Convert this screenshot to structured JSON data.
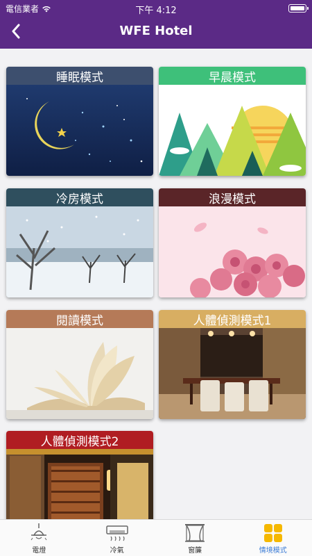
{
  "status_bar": {
    "carrier": "電信業者",
    "time": "下午 4:12"
  },
  "header": {
    "title": "WFE Hotel"
  },
  "scenes": [
    {
      "label": "睡眠模式",
      "color": "#3d4f6e"
    },
    {
      "label": "早晨模式",
      "color": "#3ec07a"
    },
    {
      "label": "冷房模式",
      "color": "#2f4f5e"
    },
    {
      "label": "浪漫模式",
      "color": "#5a2528"
    },
    {
      "label": "閱讀模式",
      "color": "#b57a58"
    },
    {
      "label": "人體偵測模式1",
      "color": "#d8ae62"
    },
    {
      "label": "人體偵測模式2",
      "color": "#b01d22"
    }
  ],
  "tabs": [
    {
      "label": "電燈",
      "icon": "lamp-icon"
    },
    {
      "label": "冷氣",
      "icon": "air-conditioner-icon"
    },
    {
      "label": "窗簾",
      "icon": "curtain-icon"
    },
    {
      "label": "情境模式",
      "icon": "scene-grid-icon",
      "active": true
    }
  ],
  "colors": {
    "header": "#5b2a86",
    "active_tab": "#3a7bd5"
  }
}
